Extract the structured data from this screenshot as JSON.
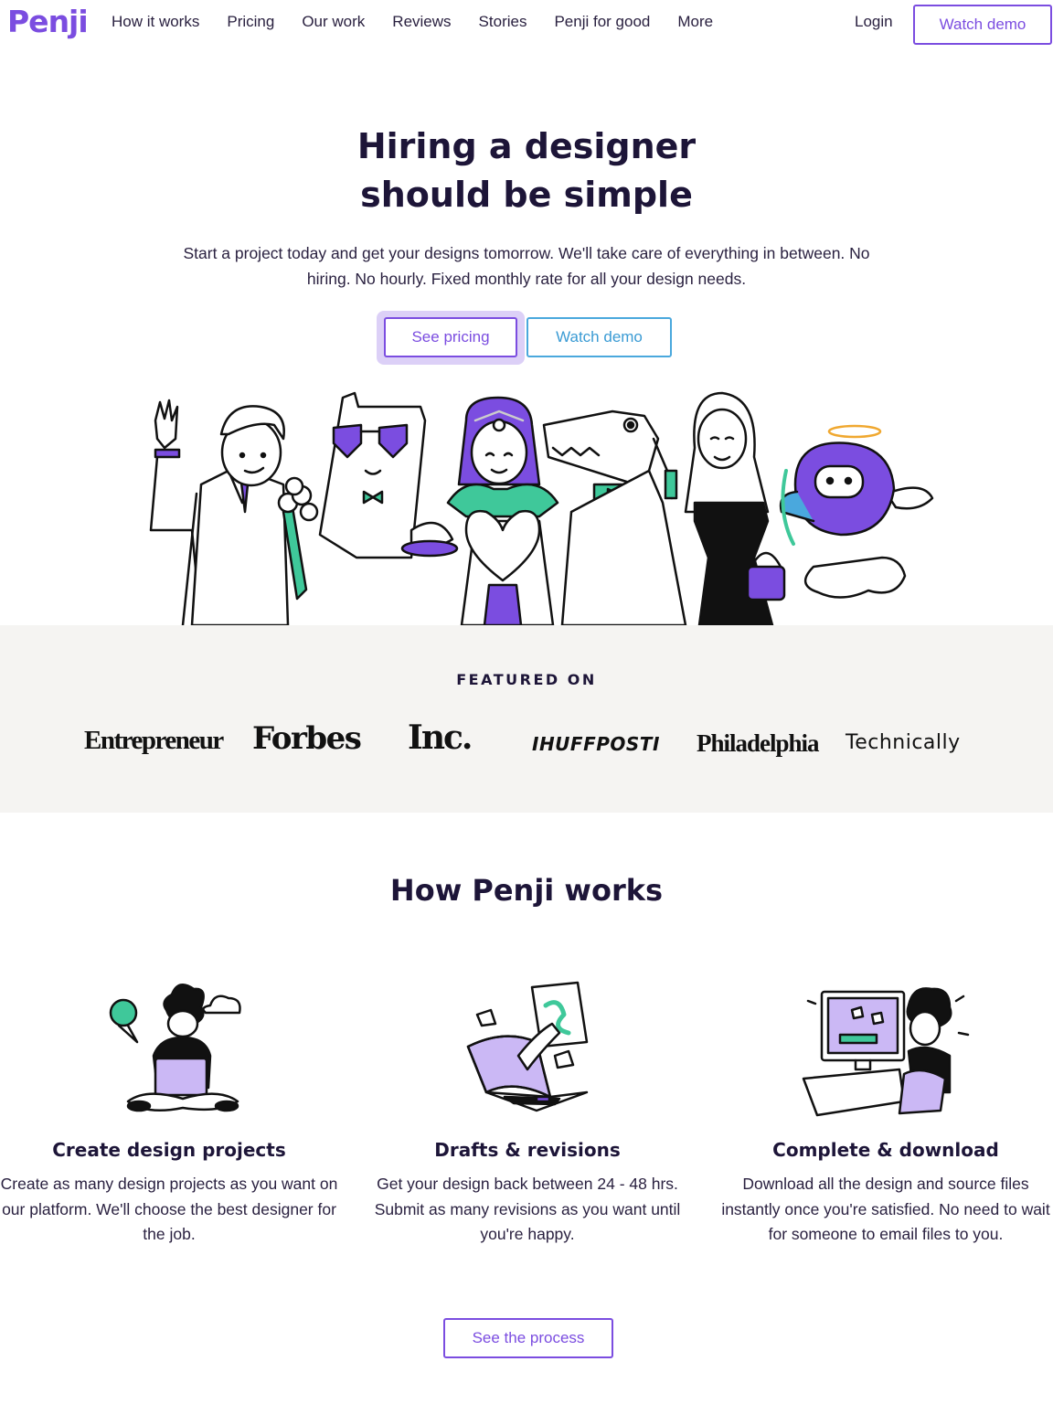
{
  "nav": {
    "logo": "Penji",
    "links": [
      "How it works",
      "Pricing",
      "Our work",
      "Reviews",
      "Stories",
      "Penji for good",
      "More"
    ],
    "login": "Login",
    "watch_demo": "Watch demo"
  },
  "hero": {
    "title_line1": "Hiring a designer",
    "title_line2": "should be simple",
    "subtitle": "Start a project today and get your designs tomorrow. We'll take care of everything in between. No hiring. No hourly. Fixed monthly rate for all your design needs.",
    "see_pricing": "See pricing",
    "watch_demo": "Watch demo"
  },
  "featured": {
    "title": "FEATURED ON",
    "press": [
      "Entrepreneur",
      "Forbes",
      "Inc.",
      "IHUFFPOSTI",
      "Philadelphia",
      "Technically"
    ]
  },
  "how": {
    "title": "How Penji works",
    "steps": [
      {
        "title": "Create design projects",
        "text": "Create as many design projects as you want on our platform. We'll choose the best designer for the job."
      },
      {
        "title": "Drafts & revisions",
        "text": "Get your design back between 24 - 48 hrs. Submit as many revisions as you want until you're happy."
      },
      {
        "title": "Complete & download",
        "text": "Download all the design and source files instantly once you're satisfied. No need to wait for someone to email files to you."
      }
    ],
    "cta": "See the process"
  },
  "colors": {
    "brand_purple": "#7b4de0",
    "accent_green": "#3fc89a",
    "accent_blue": "#4aa8dd",
    "heading": "#1d1538",
    "featured_bg": "#f5f4f2"
  }
}
